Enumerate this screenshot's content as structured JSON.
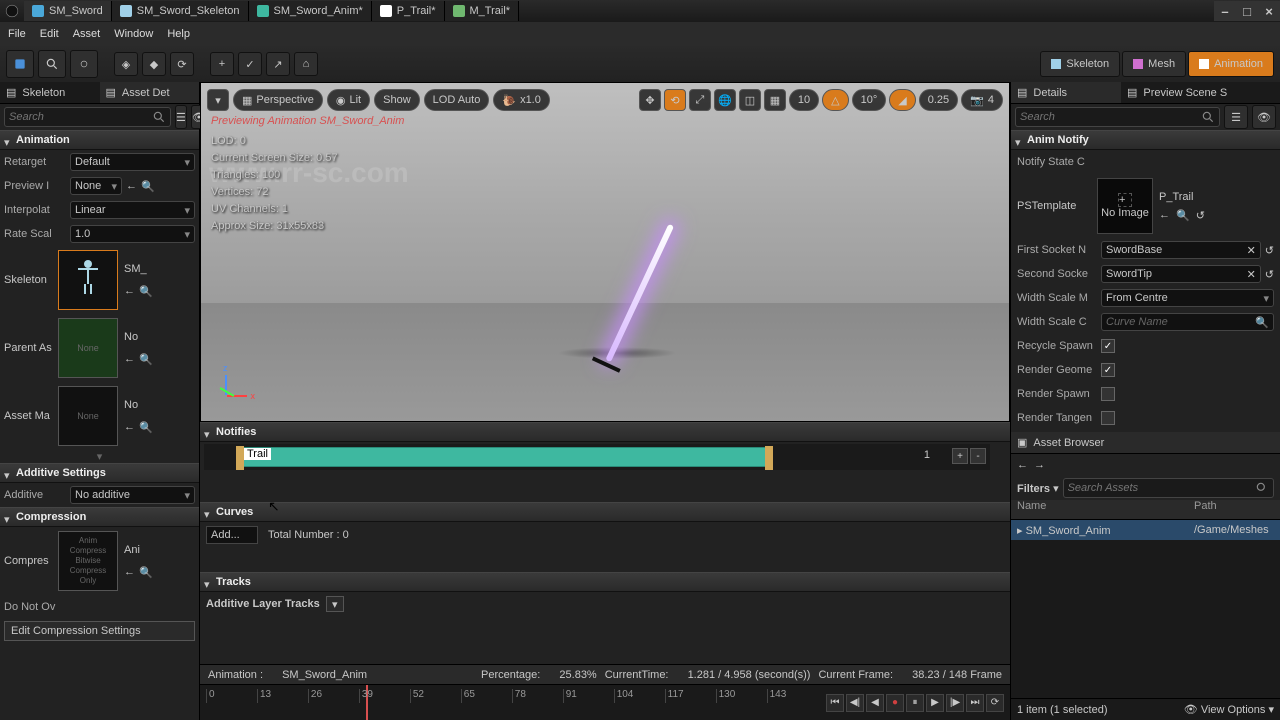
{
  "app": {
    "logo": "U"
  },
  "tabs": [
    {
      "label": "SM_Sword"
    },
    {
      "label": "SM_Sword_Skeleton"
    },
    {
      "label": "SM_Sword_Anim*"
    },
    {
      "label": "P_Trail*"
    },
    {
      "label": "M_Trail*"
    }
  ],
  "menu": {
    "file": "File",
    "edit": "Edit",
    "asset": "Asset",
    "window": "Window",
    "help": "Help"
  },
  "mode_buttons": {
    "skeleton": "Skeleton",
    "mesh": "Mesh",
    "animation": "Animation"
  },
  "left": {
    "tab1": "Skeleton",
    "tab2": "Asset Det",
    "search_ph": "Search",
    "section_anim": "Animation",
    "retarget_lbl": "Retarget",
    "retarget_val": "Default",
    "preview_lbl": "Preview I",
    "preview_val": "None",
    "interp_lbl": "Interpolat",
    "interp_val": "Linear",
    "rate_lbl": "Rate Scal",
    "rate_val": "1.0",
    "skeleton_lbl": "Skeleton",
    "skeleton_dd": "SM_",
    "parent_lbl": "Parent As",
    "parent_val": "None",
    "parent_dd": "No",
    "assetmap_lbl": "Asset Ma",
    "assetmap_val": "None",
    "assetmap_dd": "No",
    "section_additive": "Additive Settings",
    "additive_lbl": "Additive",
    "additive_val": "No additive",
    "section_compress": "Compression",
    "compress_lbl": "Compres",
    "compress_thumb": "Anim Compress Bitwise Compress Only",
    "compress_dd": "Ani",
    "donotov_lbl": "Do Not Ov",
    "edit_btn": "Edit Compression Settings"
  },
  "viewport": {
    "preview_msg": "Previewing Animation SM_Sword_Anim",
    "persp": "Perspective",
    "lit": "Lit",
    "show": "Show",
    "lod": "LOD Auto",
    "speed": "x1.0",
    "snap_deg": "10",
    "snap_rot": "10°",
    "snap_scale": "0.25",
    "cam_speed": "4",
    "lod_line": "LOD: 0",
    "screensize": "Current Screen Size: 0.57",
    "triangles": "Triangles: 100",
    "vertices": "Vertices: 72",
    "uvchannels": "UV Channels: 1",
    "approx": "Approx Size: 31x55x83"
  },
  "notifies": {
    "header": "Notifies",
    "trail": "Trail",
    "index": "1",
    "plus": "+",
    "minus": "-"
  },
  "curves": {
    "header": "Curves",
    "add": "Add...",
    "total": "Total Number : 0"
  },
  "tracks": {
    "header": "Tracks",
    "layer": "Additive Layer Tracks"
  },
  "status": {
    "anim_lbl": "Animation :",
    "anim_name": "SM_Sword_Anim",
    "pct_lbl": "Percentage:",
    "pct_val": "25.83%",
    "time_lbl": "CurrentTime:",
    "time_val": "1.281 / 4.958 (second(s))",
    "frame_lbl": "Current Frame:",
    "frame_val": "38.23 / 148 Frame"
  },
  "ruler": {
    "ticks": [
      "0",
      "13",
      "26",
      "39",
      "52",
      "65",
      "78",
      "91",
      "104",
      "117",
      "130",
      "143"
    ]
  },
  "right": {
    "tab_details": "Details",
    "tab_preview": "Preview Scene S",
    "search_ph": "Search",
    "section_notify": "Anim Notify",
    "notifystate_lbl": "Notify State C",
    "pstemplate_lbl": "PSTemplate",
    "pstemplate_val": "P_Trail",
    "noimage": "No Image",
    "firstsocket_lbl": "First Socket N",
    "firstsocket_val": "SwordBase",
    "secondsocket_lbl": "Second Socke",
    "secondsocket_val": "SwordTip",
    "widthscalem_lbl": "Width Scale M",
    "widthscalem_val": "From Centre",
    "widthscalec_lbl": "Width Scale C",
    "widthscalec_ph": "Curve Name",
    "recycle_lbl": "Recycle Spawn",
    "recycle_chk": true,
    "rendergeo_lbl": "Render Geome",
    "rendergeo_chk": true,
    "renderspawn_lbl": "Render Spawn",
    "renderspawn_chk": false,
    "rendertan_lbl": "Render Tangen",
    "rendertan_chk": false,
    "browser_head": "Asset Browser",
    "filters": "Filters",
    "search_assets_ph": "Search Assets",
    "col_name": "Name",
    "col_path": "Path",
    "row_name": "SM_Sword_Anim",
    "row_path": "/Game/Meshes",
    "footer": "1 item (1 selected)",
    "viewopt": "View Options"
  },
  "watermark": "www.rr-sc.com"
}
